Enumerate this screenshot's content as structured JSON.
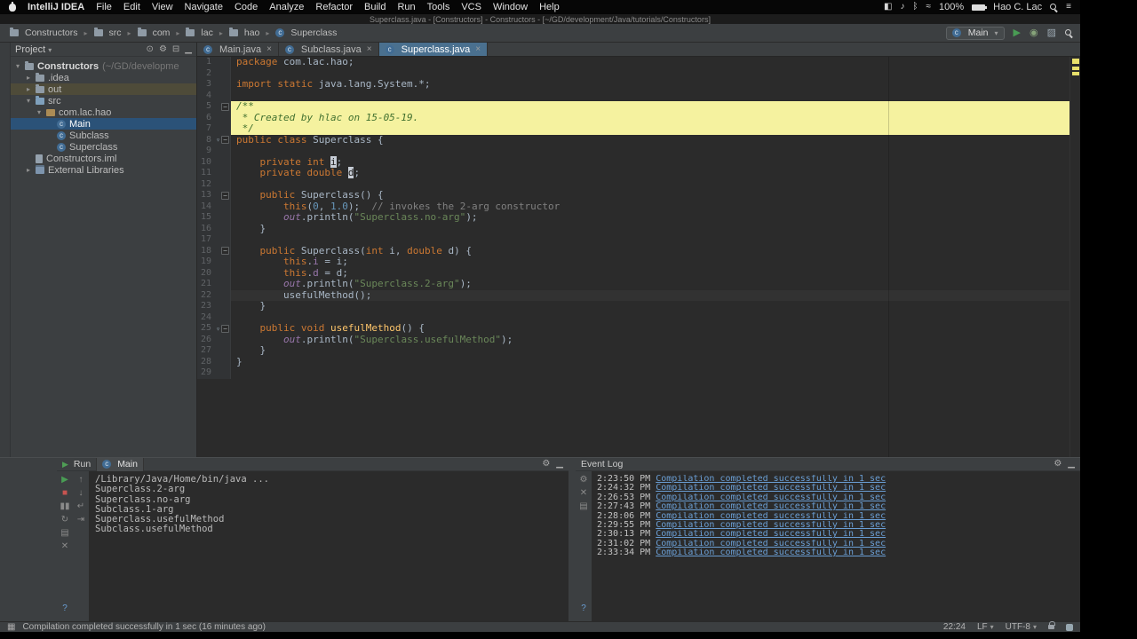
{
  "colors": {
    "accent_tab": "#4a708f",
    "selection": "#2b5278",
    "search_highlight": "#f5f29f",
    "link": "#6a9ed4",
    "keyword": "#cc7832",
    "string": "#6a8759",
    "run_green": "#499c54",
    "stop_red": "#c75450"
  },
  "menubar": {
    "app_name": "IntelliJ IDEA",
    "items": [
      "File",
      "Edit",
      "View",
      "Navigate",
      "Code",
      "Analyze",
      "Refactor",
      "Build",
      "Run",
      "Tools",
      "VCS",
      "Window",
      "Help"
    ],
    "right": {
      "icons": [
        {
          "name": "display-icon",
          "g": "◧"
        },
        {
          "name": "volume-icon",
          "g": "♪"
        },
        {
          "name": "bluetooth-icon",
          "g": "ᛒ"
        },
        {
          "name": "wifi-icon",
          "g": "≈"
        }
      ],
      "battery": "100%",
      "user": "Hao C. Lac",
      "trailing_icons": [
        {
          "name": "spotlight-icon",
          "kind": "mag"
        },
        {
          "name": "notification-center-icon",
          "g": "≡"
        }
      ]
    }
  },
  "titlebar": {
    "title": "Superclass.java - [Constructors] - Constructors - [~/GD/development/Java/tutorials/Constructors]"
  },
  "navbar": {
    "crumbs": [
      {
        "label": "Constructors",
        "icon": "folder"
      },
      {
        "label": "src",
        "icon": "folder"
      },
      {
        "label": "com",
        "icon": "folder"
      },
      {
        "label": "lac",
        "icon": "folder"
      },
      {
        "label": "hao",
        "icon": "folder"
      },
      {
        "label": "Superclass",
        "icon": "class"
      }
    ],
    "run_config": {
      "label": "Main"
    },
    "right_icons": [
      {
        "name": "run-icon",
        "g": "▶",
        "c": "#499c54"
      },
      {
        "name": "debug-icon",
        "g": "◉",
        "c": "#86a37a"
      },
      {
        "name": "coverage-icon",
        "g": "▨",
        "c": "#9aa7b0"
      },
      {
        "name": "search-everywhere-icon",
        "kind": "mag"
      }
    ]
  },
  "project": {
    "title": "Project",
    "header_icons": [
      {
        "name": "scroll-from-source-icon",
        "g": "⊙"
      },
      {
        "name": "settings-icon",
        "g": "⚙"
      },
      {
        "name": "collapse-all-icon",
        "g": "⊟"
      },
      {
        "name": "hide-panel-icon",
        "g": "▁"
      }
    ],
    "tree": [
      {
        "label": "Constructors",
        "detail": "(~/GD/developme",
        "icon": "folder",
        "depth": 0,
        "arrow": "open",
        "row": "root"
      },
      {
        "label": ".idea",
        "icon": "folder",
        "depth": 1,
        "arrow": "closed"
      },
      {
        "label": "out",
        "icon": "folder",
        "depth": 1,
        "arrow": "closed",
        "row": "excluded"
      },
      {
        "label": "src",
        "icon": "folder-src",
        "depth": 1,
        "arrow": "open"
      },
      {
        "label": "com.lac.hao",
        "icon": "pkg",
        "depth": 2,
        "arrow": "open"
      },
      {
        "label": "Main",
        "icon": "class",
        "depth": 3,
        "arrow": "none",
        "row": "selected"
      },
      {
        "label": "Subclass",
        "icon": "class",
        "depth": 3,
        "arrow": "none"
      },
      {
        "label": "Superclass",
        "icon": "class",
        "depth": 3,
        "arrow": "none"
      },
      {
        "label": "Constructors.iml",
        "icon": "file",
        "depth": 1,
        "arrow": "none"
      },
      {
        "label": "External Libraries",
        "icon": "lib",
        "depth": 1,
        "arrow": "closed"
      }
    ]
  },
  "tabs": [
    {
      "label": "Main.java",
      "active": false
    },
    {
      "label": "Subclass.java",
      "active": false
    },
    {
      "label": "Superclass.java",
      "active": true
    }
  ],
  "editor": {
    "lines": [
      {
        "seg": [
          [
            "k",
            "package"
          ],
          [
            "p",
            " com.lac.hao;"
          ]
        ]
      },
      {
        "seg": []
      },
      {
        "seg": [
          [
            "k",
            "import static"
          ],
          [
            "p",
            " java.lang.System.*;"
          ]
        ]
      },
      {
        "seg": []
      },
      {
        "hl": "y",
        "fold": true,
        "seg": [
          [
            "jd",
            "/**"
          ]
        ]
      },
      {
        "hl": "y",
        "seg": [
          [
            "jd",
            " * Created by hlac on 15-05-19."
          ]
        ]
      },
      {
        "hl": "y",
        "seg": [
          [
            "jd",
            " */"
          ]
        ]
      },
      {
        "fold": true,
        "marker": true,
        "seg": [
          [
            "k",
            "public class"
          ],
          [
            "p",
            " Superclass {"
          ]
        ]
      },
      {
        "seg": []
      },
      {
        "seg": [
          [
            "p",
            "    "
          ],
          [
            "k",
            "private int"
          ],
          [
            "p",
            " "
          ],
          [
            "fh",
            "i"
          ],
          [
            "p",
            ";"
          ]
        ]
      },
      {
        "seg": [
          [
            "p",
            "    "
          ],
          [
            "k",
            "private double"
          ],
          [
            "p",
            " "
          ],
          [
            "fh",
            "d"
          ],
          [
            "p",
            ";"
          ]
        ]
      },
      {
        "seg": []
      },
      {
        "fold": true,
        "seg": [
          [
            "p",
            "    "
          ],
          [
            "k",
            "public"
          ],
          [
            "p",
            " Superclass() {"
          ]
        ]
      },
      {
        "seg": [
          [
            "p",
            "        "
          ],
          [
            "k",
            "this"
          ],
          [
            "p",
            "("
          ],
          [
            "n",
            "0"
          ],
          [
            "p",
            ", "
          ],
          [
            "n",
            "1.0"
          ],
          [
            "p",
            ");  "
          ],
          [
            "c",
            "// invokes the 2-arg constructor"
          ]
        ]
      },
      {
        "seg": [
          [
            "p",
            "        "
          ],
          [
            "si",
            "out"
          ],
          [
            "p",
            ".println("
          ],
          [
            "s",
            "\"Superclass.no-arg\""
          ],
          [
            "p",
            ");"
          ]
        ]
      },
      {
        "seg": [
          [
            "p",
            "    }"
          ]
        ]
      },
      {
        "seg": []
      },
      {
        "fold": true,
        "seg": [
          [
            "p",
            "    "
          ],
          [
            "k",
            "public"
          ],
          [
            "p",
            " Superclass("
          ],
          [
            "k",
            "int"
          ],
          [
            "p",
            " i, "
          ],
          [
            "k",
            "double"
          ],
          [
            "p",
            " d) {"
          ]
        ]
      },
      {
        "seg": [
          [
            "p",
            "        "
          ],
          [
            "k",
            "this"
          ],
          [
            "p",
            "."
          ],
          [
            "f",
            "i"
          ],
          [
            "p",
            " = i;"
          ]
        ]
      },
      {
        "seg": [
          [
            "p",
            "        "
          ],
          [
            "k",
            "this"
          ],
          [
            "p",
            "."
          ],
          [
            "f",
            "d"
          ],
          [
            "p",
            " = d;"
          ]
        ]
      },
      {
        "seg": [
          [
            "p",
            "        "
          ],
          [
            "si",
            "out"
          ],
          [
            "p",
            ".println("
          ],
          [
            "s",
            "\"Superclass.2-arg\""
          ],
          [
            "p",
            ");"
          ]
        ]
      },
      {
        "hl": "cur",
        "seg": [
          [
            "p",
            "        usefulMethod();"
          ]
        ]
      },
      {
        "seg": [
          [
            "p",
            "    }"
          ]
        ]
      },
      {
        "seg": []
      },
      {
        "fold": true,
        "marker": true,
        "seg": [
          [
            "p",
            "    "
          ],
          [
            "k",
            "public void"
          ],
          [
            "p",
            " "
          ],
          [
            "m",
            "usefulMethod"
          ],
          [
            "p",
            "() {"
          ]
        ]
      },
      {
        "seg": [
          [
            "p",
            "        "
          ],
          [
            "si",
            "out"
          ],
          [
            "p",
            ".println("
          ],
          [
            "s",
            "\"Superclass.usefulMethod\""
          ],
          [
            "p",
            ");"
          ]
        ]
      },
      {
        "seg": [
          [
            "p",
            "    }"
          ]
        ]
      },
      {
        "seg": [
          [
            "p",
            "}"
          ]
        ]
      },
      {
        "seg": []
      }
    ]
  },
  "run": {
    "title": "Run",
    "tab": "Main",
    "header_icons": [
      {
        "name": "settings-icon",
        "g": "⚙"
      },
      {
        "name": "minimize-icon",
        "g": "▁"
      }
    ],
    "toolbar_main": [
      {
        "name": "rerun-icon",
        "g": "▶",
        "c": "#499c54"
      },
      {
        "name": "stop-icon",
        "g": "■",
        "c": "#c75450"
      },
      {
        "name": "pause-icon",
        "g": "▮▮",
        "c": "#8a8a8a"
      },
      {
        "name": "restore-layout-icon",
        "g": "↻",
        "c": "#8a8a8a"
      },
      {
        "name": "print-icon",
        "g": "▤",
        "c": "#8a8a8a"
      },
      {
        "name": "clear-icon",
        "g": "✕",
        "c": "#8a8a8a"
      },
      {
        "name": "help-icon",
        "g": "?",
        "c": "#6a9ed4",
        "push": true
      }
    ],
    "toolbar_console": [
      {
        "name": "up-stack-trace-icon",
        "g": "↑",
        "c": "#8a8a8a"
      },
      {
        "name": "down-stack-trace-icon",
        "g": "↓",
        "c": "#8a8a8a"
      },
      {
        "name": "soft-wrap-icon",
        "g": "↵",
        "c": "#8a8a8a"
      },
      {
        "name": "scroll-to-end-icon",
        "g": "⇥",
        "c": "#8a8a8a"
      }
    ],
    "console": [
      "/Library/Java/Home/bin/java ...",
      "Superclass.2-arg",
      "Superclass.no-arg",
      "Subclass.1-arg",
      "Superclass.usefulMethod",
      "Subclass.usefulMethod"
    ]
  },
  "event_log": {
    "title": "Event Log",
    "header_icons": [
      {
        "name": "settings-icon",
        "g": "⚙"
      },
      {
        "name": "minimize-icon",
        "g": "▁"
      }
    ],
    "toolbar": [
      {
        "name": "settings-icon",
        "g": "⚙",
        "c": "#8a8a8a"
      },
      {
        "name": "clear-all-icon",
        "g": "✕",
        "c": "#8a8a8a"
      },
      {
        "name": "mark-all-read-icon",
        "g": "▤",
        "c": "#8a8a8a"
      },
      {
        "name": "help-icon",
        "g": "?",
        "c": "#6a9ed4",
        "push": true
      }
    ],
    "entries": [
      {
        "time": "2:23:50 PM",
        "message": "Compilation completed successfully in 1 sec"
      },
      {
        "time": "2:24:32 PM",
        "message": "Compilation completed successfully in 1 sec"
      },
      {
        "time": "2:26:53 PM",
        "message": "Compilation completed successfully in 1 sec"
      },
      {
        "time": "2:27:43 PM",
        "message": "Compilation completed successfully in 1 sec"
      },
      {
        "time": "2:28:06 PM",
        "message": "Compilation completed successfully in 1 sec"
      },
      {
        "time": "2:29:55 PM",
        "message": "Compilation completed successfully in 1 sec"
      },
      {
        "time": "2:30:13 PM",
        "message": "Compilation completed successfully in 1 sec"
      },
      {
        "time": "2:31:02 PM",
        "message": "Compilation completed successfully in 1 sec"
      },
      {
        "time": "2:33:34 PM",
        "message": "Compilation completed successfully in 1 sec"
      }
    ]
  },
  "statusbar": {
    "toggle_icon": "▦",
    "message": "Compilation completed successfully in 1 sec (16 minutes ago)",
    "caret_position": "22:24",
    "line_separator": "LF",
    "encoding": "UTF-8"
  }
}
